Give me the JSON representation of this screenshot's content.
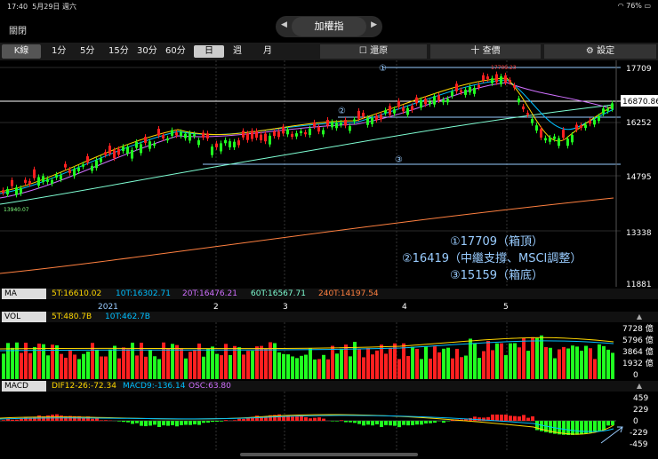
{
  "status": {
    "time": "17:40",
    "date": "5月29日 週六",
    "battery": "76%"
  },
  "header": {
    "close_label": "關閉",
    "title": "加權指",
    "prev_arrow": "◀",
    "next_arrow": "▶"
  },
  "toolbar": {
    "kline": "K線",
    "periods": [
      "1分",
      "5分",
      "15分",
      "30分",
      "60分",
      "日",
      "週",
      "月"
    ],
    "restore": "還原",
    "query": "十 查價",
    "settings": "⚙ 設定"
  },
  "main_chart": {
    "y_ticks": [
      "17709",
      "16870.86",
      "16252",
      "14795",
      "13338",
      "11881"
    ],
    "peak_label": "17709.23",
    "low_label": "13940.07",
    "annotations": [
      "①17709（箱頂）",
      "②16419（中繼支撐、MSCI調整）",
      "③15159（箱底）"
    ],
    "markers": [
      "①",
      "②",
      "③"
    ],
    "x_labels": [
      "2021",
      "2",
      "3",
      "4",
      "5"
    ]
  },
  "ma_bar": {
    "label": "MA",
    "values": [
      {
        "text": "5T:16610.02",
        "color": "#ffd700"
      },
      {
        "text": "10T:16302.71",
        "color": "#00bfff"
      },
      {
        "text": "20T:16476.21",
        "color": "#d070ff"
      },
      {
        "text": "60T:16567.71",
        "color": "#7fffd4"
      },
      {
        "text": "240T:14197.54",
        "color": "#ff8040"
      }
    ]
  },
  "vol_bar": {
    "label": "VOL",
    "values": [
      {
        "text": "5T:480.7B",
        "color": "#ffd700"
      },
      {
        "text": "10T:462.7B",
        "color": "#00bfff"
      }
    ],
    "y_ticks": [
      "7728 億",
      "5796 億",
      "3864 億",
      "1932 億",
      "0"
    ]
  },
  "macd_bar": {
    "label": "MACD",
    "values": [
      {
        "text": "DIF12-26:-72.34",
        "color": "#ffd700"
      },
      {
        "text": "MACD9:-136.14",
        "color": "#00bfff"
      },
      {
        "text": "OSC:63.80",
        "color": "#d070ff"
      }
    ],
    "y_ticks": [
      "459",
      "229",
      "0",
      "-229",
      "-459"
    ]
  },
  "colors": {
    "up": "#ff2020",
    "down": "#20ff20",
    "bg": "#000000"
  }
}
